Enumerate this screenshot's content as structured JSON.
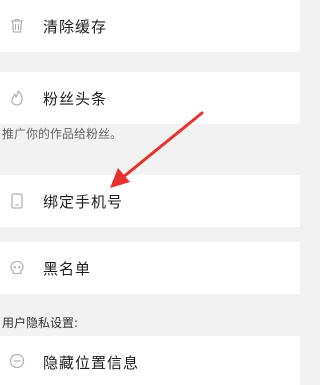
{
  "items": [
    {
      "label": "清除缓存",
      "icon": "trash-icon"
    },
    {
      "label": "粉丝头条",
      "icon": "flame-icon"
    },
    {
      "label": "绑定手机号",
      "icon": "phone-icon"
    },
    {
      "label": "黑名单",
      "icon": "skull-icon"
    },
    {
      "label": "隐藏位置信息",
      "icon": "hide-location-icon"
    }
  ],
  "notes": {
    "fans_tip": "推广你的作品给粉丝。",
    "privacy_header": "用户隐私设置:"
  },
  "colors": {
    "arrow": "#e8322f",
    "icon": "#b5b5b5"
  }
}
